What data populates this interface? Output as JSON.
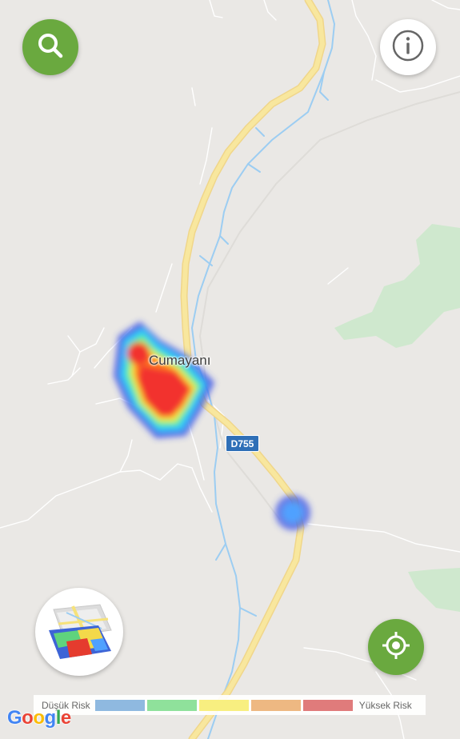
{
  "map": {
    "place_label": "Cumayanı",
    "route_label": "D755"
  },
  "controls": {
    "search_icon": "magnifier-icon",
    "info_icon": "info-circle-icon",
    "layers_icon": "heatmap-layers-icon",
    "locate_icon": "crosshair-locate-icon"
  },
  "legend": {
    "low_label": "Düşük Risk",
    "high_label": "Yüksek Risk",
    "scale_colors": [
      "#8fb9e0",
      "#8fe19b",
      "#f8ef80",
      "#eeb882",
      "#e07b7b"
    ]
  },
  "attribution": {
    "text": "Google"
  },
  "colors": {
    "primary_green": "#6aa93f",
    "road": "#f6e29a",
    "water": "#9ccdf2",
    "park": "#cfe8ce",
    "map_background": "#eae8e5"
  }
}
